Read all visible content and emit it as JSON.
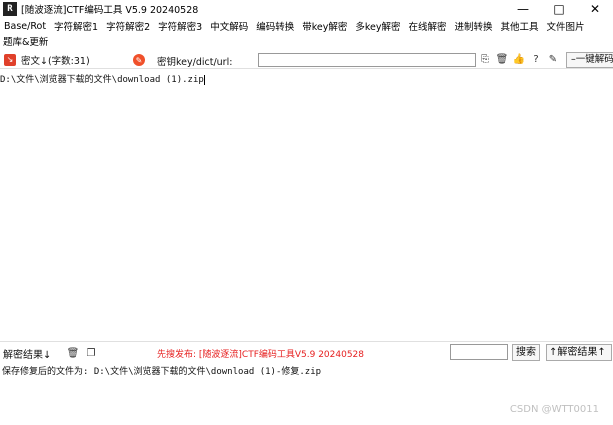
{
  "window": {
    "icon_text": "R",
    "title": "[随波逐流]CTF编码工具 V5.9 20240528",
    "minimize": "—",
    "maximize": "□",
    "close": "✕"
  },
  "menu": {
    "row1": [
      "Base/Rot",
      "字符解密1",
      "字符解密2",
      "字符解密3",
      "中文解码",
      "编码转换",
      "带key解密",
      "多key解密",
      "在线解密",
      "进制转换",
      "其他工具",
      "文件图片"
    ],
    "row2": [
      "题库&更新"
    ]
  },
  "toolbar_cipher": {
    "cipher_label": "密文↓(字数:31)",
    "key_label": "密钥key/dict/url:",
    "key_value": "",
    "one_click_label": "一键解码"
  },
  "cipher_text": "D:\\文件\\浏览器下载的文件\\download (1).zip",
  "toolbar_result": {
    "result_label": "解密结果↓",
    "promo_text": "先搜发布: [随波逐流]CTF编码工具V5.9 20240528",
    "search_value": "",
    "search_label": "搜索",
    "up_label": "↑解密结果↑"
  },
  "result_text": "保存修复后的文件为: D:\\文件\\浏览器下载的文件\\download (1)-修复.zip",
  "watermark": "CSDN @WTT0011",
  "icons": {
    "cipher_icon": "red-box-arrow-icon",
    "clear_icon": "orange-clear-icon",
    "paste_icon": "paste-icon",
    "trash_icon": "trash-icon",
    "like_icon": "thumbs-up-icon",
    "help_icon": "help-icon",
    "edit_icon": "edit-icon"
  },
  "colors": {
    "accent_red": "#e0402a",
    "promo_red": "#e62020"
  }
}
